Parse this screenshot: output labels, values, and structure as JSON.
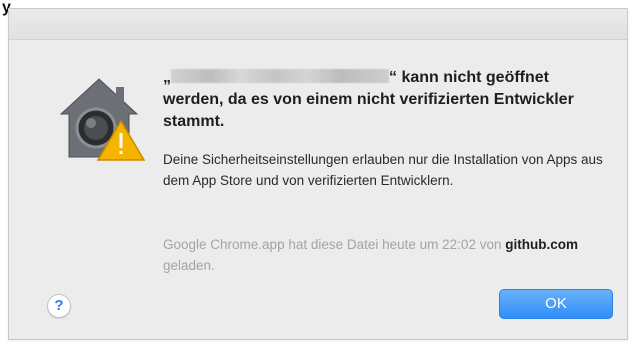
{
  "overlay": {
    "top_label": "y"
  },
  "dialog": {
    "headline": {
      "prefix": "„",
      "app_name_redacted": "",
      "suffix": "“ kann nicht geöffnet werden, da es von einem nicht verifizierten Entwickler stammt."
    },
    "info_text": "Deine Sicherheitseinstellungen erlauben nur die Installation von Apps aus dem App Store und von verifizierten Entwicklern.",
    "source": {
      "prefix": "Google Chrome.app hat diese Datei heute um 22:02 von",
      "domain": "github.com",
      "suffix": "geladen."
    },
    "help_label": "?",
    "ok_label": "OK"
  },
  "icons": {
    "app_icon": "gatekeeper-warning-icon"
  },
  "colors": {
    "dialog_bg": "#ececec",
    "ok_button": "#2f8df7",
    "warning_triangle": "#f4b400",
    "help_question": "#2d7ce8"
  }
}
